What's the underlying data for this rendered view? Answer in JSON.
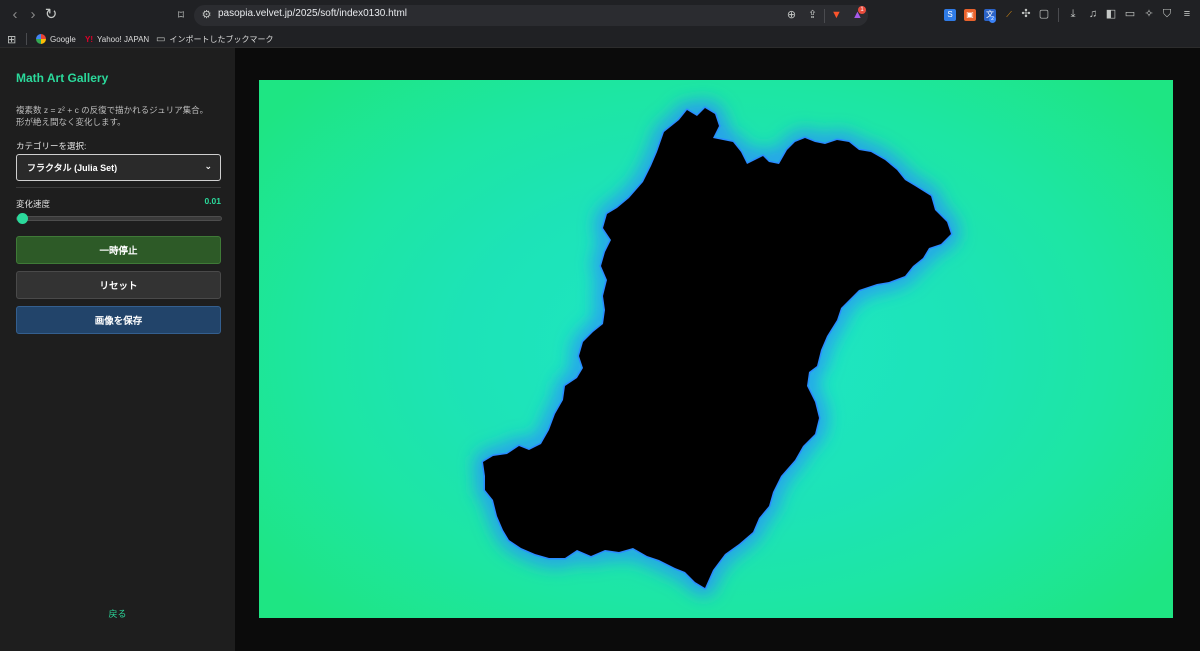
{
  "browser": {
    "url": "pasopia.velvet.jp/2025/soft/index0130.html",
    "bookmarks": [
      {
        "label": "Google"
      },
      {
        "label": "Yahoo! JAPAN"
      },
      {
        "label": "インポートしたブックマーク"
      }
    ],
    "icons": {
      "back": "back-arrow-icon",
      "forward": "forward-arrow-icon",
      "reload": "reload-icon",
      "bookmark": "bookmark-icon",
      "site_info": "tune-icon",
      "zoom": "zoom-icon",
      "share": "share-icon",
      "brave": "brave-lion-icon",
      "rewards": "rewards-triangle-icon",
      "download": "download-icon",
      "media": "music-note-icon",
      "sidebar": "sidebar-icon",
      "wallet": "wallet-icon",
      "leo": "leo-star-icon",
      "vpn": "shield-icon",
      "menu": "menu-icon",
      "apps": "apps-grid-icon"
    },
    "rewards_badge": "1",
    "extension_badge": "2"
  },
  "sidebar": {
    "title": "Math Art Gallery",
    "description_line1": "複素数 z = z² + c の反復で描かれるジュリア集合。",
    "description_line2": "形が絶え間なく変化します。",
    "category_label": "カテゴリーを選択:",
    "category_selected": "フラクタル (Julia Set)",
    "speed_label": "変化速度",
    "speed_value": "0.01",
    "speed_fraction": 0.0,
    "pause_button": "一時停止",
    "reset_button": "リセット",
    "save_button": "画像を保存",
    "back_link": "戻る"
  },
  "colors": {
    "accent": "#2bd99b",
    "pause_bg": "#2d5a27",
    "save_bg": "#22446a",
    "fractal_fill": "#000000",
    "fractal_glow": "#2a8cff",
    "background_green": "#1ee583"
  }
}
